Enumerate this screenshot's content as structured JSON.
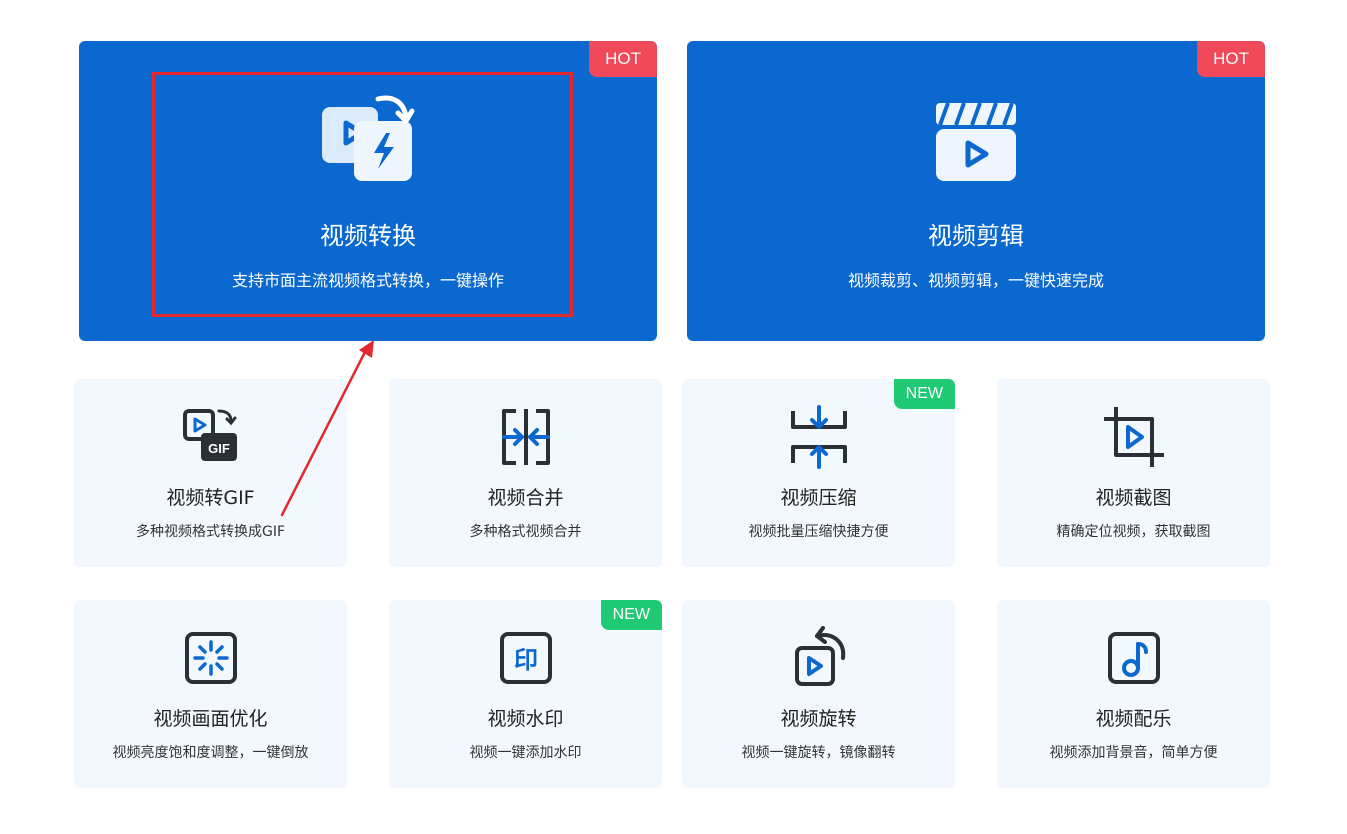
{
  "colors": {
    "primary": "#0a68cf",
    "hot_badge": "#f0495a",
    "new_badge": "#20c974",
    "card_bg": "#f2f8fd",
    "annotation": "#e0282e"
  },
  "featured": [
    {
      "title": "视频转换",
      "desc": "支持市面主流视频格式转换，一键操作",
      "badge": "HOT",
      "icon": "convert-video-icon"
    },
    {
      "title": "视频剪辑",
      "desc": "视频裁剪、视频剪辑，一键快速完成",
      "badge": "HOT",
      "icon": "clapperboard-icon"
    }
  ],
  "tools": [
    {
      "title": "视频转GIF",
      "desc": "多种视频格式转换成GIF",
      "badge": "",
      "icon": "gif-convert-icon"
    },
    {
      "title": "视频合并",
      "desc": "多种格式视频合并",
      "badge": "",
      "icon": "merge-icon"
    },
    {
      "title": "视频压缩",
      "desc": "视频批量压缩快捷方便",
      "badge": "NEW",
      "icon": "compress-icon"
    },
    {
      "title": "视频截图",
      "desc": "精确定位视频，获取截图",
      "badge": "",
      "icon": "crop-icon"
    },
    {
      "title": "视频画面优化",
      "desc": "视频亮度饱和度调整，一键倒放",
      "badge": "",
      "icon": "enhance-icon"
    },
    {
      "title": "视频水印",
      "desc": "视频一键添加水印",
      "badge": "NEW",
      "icon": "watermark-icon"
    },
    {
      "title": "视频旋转",
      "desc": "视频一键旋转，镜像翻转",
      "badge": "",
      "icon": "rotate-icon"
    },
    {
      "title": "视频配乐",
      "desc": "视频添加背景音，简单方便",
      "badge": "",
      "icon": "music-icon"
    }
  ]
}
